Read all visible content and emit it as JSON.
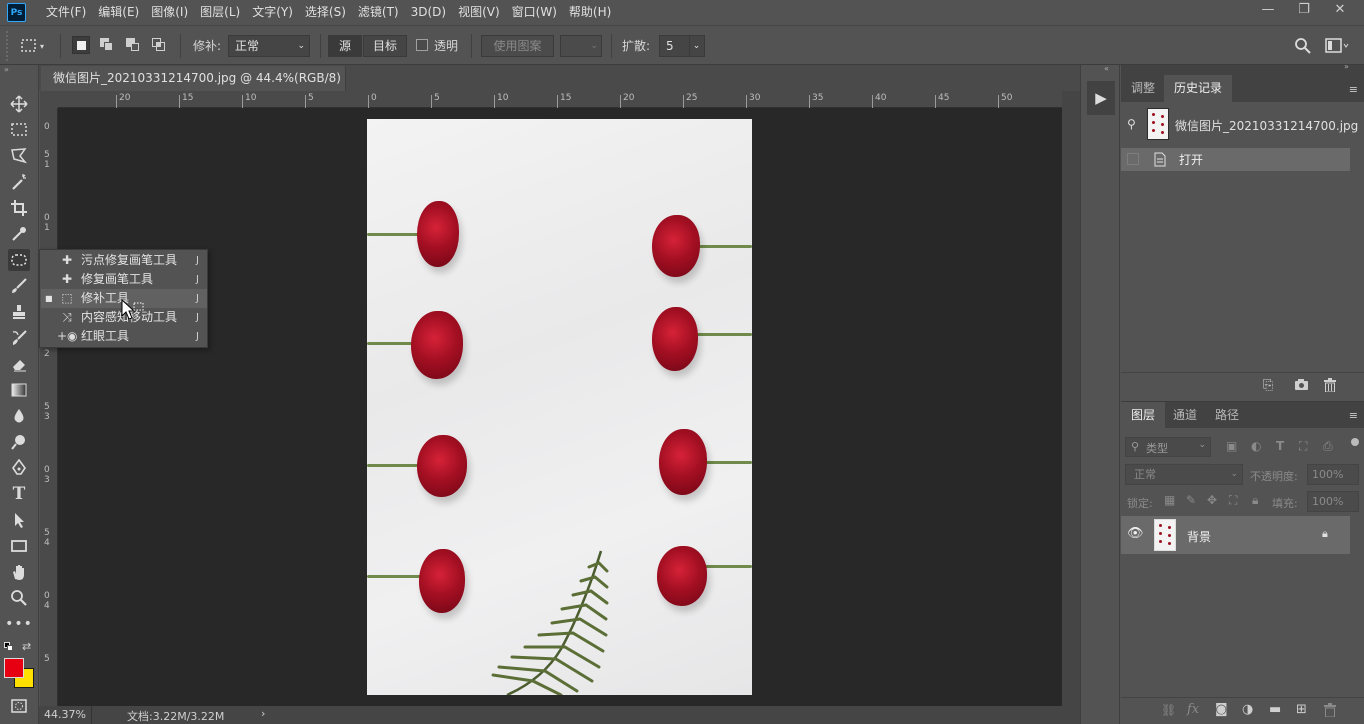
{
  "app": {
    "logo": "Ps",
    "colors": {
      "accent": "#31a8ff",
      "panel": "#535353",
      "canvas_bg": "#282828",
      "foreground": "#e60012",
      "background": "#ffe000"
    }
  },
  "menu": [
    "文件(F)",
    "编辑(E)",
    "图像(I)",
    "图层(L)",
    "文字(Y)",
    "选择(S)",
    "滤镜(T)",
    "3D(D)",
    "视图(V)",
    "窗口(W)",
    "帮助(H)"
  ],
  "window_controls": {
    "minimize": "—",
    "restore": "❐",
    "close": "✕"
  },
  "options": {
    "patch_label": "修补:",
    "patch_mode": "正常",
    "source": "源",
    "target": "目标",
    "transparent": "透明",
    "use_pattern": "使用图案",
    "diffusion_label": "扩散:",
    "diffusion_value": "5"
  },
  "document": {
    "tab_title": "微信图片_20210331214700.jpg @ 44.4%(RGB/8) *",
    "close": "×",
    "ruler_top": [
      "20",
      "15",
      "10",
      "5",
      "0",
      "5",
      "10",
      "15",
      "20",
      "25",
      "30",
      "35",
      "40",
      "45",
      "50"
    ],
    "ruler_left": [
      "0",
      "5",
      "1",
      "0",
      "1",
      "5",
      "2",
      "0",
      "2",
      "5",
      "3",
      "0",
      "3",
      "5",
      "4",
      "0",
      "4",
      "5"
    ]
  },
  "status": {
    "zoom": "44.37%",
    "doc": "文档:3.22M/3.22M",
    "arrow": "›"
  },
  "flyout": {
    "items": [
      {
        "label": "污点修复画笔工具",
        "key": "J",
        "icon": "spot-healing-brush-icon"
      },
      {
        "label": "修复画笔工具",
        "key": "J",
        "icon": "healing-brush-icon"
      },
      {
        "label": "修补工具",
        "key": "J",
        "icon": "patch-tool-icon",
        "active": true
      },
      {
        "label": "内容感知移动工具",
        "key": "J",
        "icon": "content-aware-move-icon"
      },
      {
        "label": "红眼工具",
        "key": "J",
        "icon": "red-eye-icon"
      }
    ]
  },
  "history_panel": {
    "tabs": [
      "调整",
      "历史记录"
    ],
    "snapshot_name": "微信图片_20210331214700.jpg",
    "steps": [
      "打开"
    ]
  },
  "layers_panel": {
    "tabs": [
      "图层",
      "通道",
      "路径"
    ],
    "filter_placeholder": "类型",
    "blend_mode": "正常",
    "opacity_label": "不透明度:",
    "opacity_value": "100%",
    "lock_label": "锁定:",
    "fill_label": "填充:",
    "fill_value": "100%",
    "layers": [
      {
        "name": "背景",
        "visible": true,
        "locked": true
      }
    ]
  }
}
